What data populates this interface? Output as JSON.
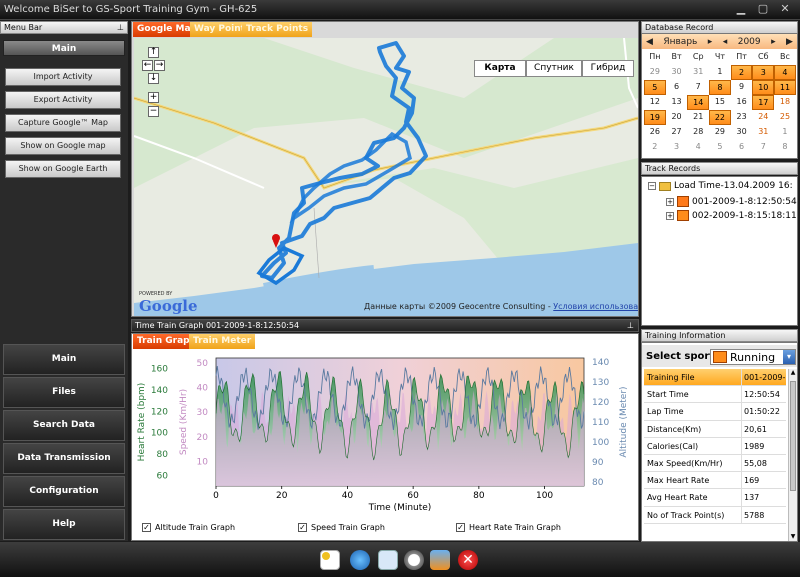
{
  "window": {
    "title": "Welcome BiSer to GS-Sport Training Gym - GH-625"
  },
  "menubar": {
    "header": "Menu Bar",
    "top_button": "Main",
    "items": [
      "Import Activity",
      "Export Activity",
      "Capture Google™ Map",
      "Show on Google map",
      "Show on Google Earth"
    ],
    "nav": [
      "Main",
      "Files",
      "Search Data",
      "Data Transmission",
      "Configuration",
      "Help"
    ]
  },
  "map": {
    "tabs": [
      "Google Map",
      "Way Points",
      "Track Points"
    ],
    "types": [
      "Карта",
      "Спутник",
      "Гибрид"
    ],
    "powered": "POWERED BY",
    "logo": "Google",
    "credit": "Данные карты ©2009 Geocentre Consulting - ",
    "credit_link": "Условия использования"
  },
  "graph": {
    "header": "Time Train Graph 001-2009-1-8:12:50:54",
    "tabs": [
      "Train Graph",
      "Train Meter"
    ],
    "checkboxes": [
      "Altitude Train Graph",
      "Speed Train Graph",
      "Heart Rate Train Graph"
    ]
  },
  "chart_data": {
    "type": "line",
    "xlabel": "Time (Minute)",
    "xlim": [
      0,
      112
    ],
    "x_ticks": [
      "0",
      "20",
      "40",
      "60",
      "80",
      "100"
    ],
    "axes": [
      {
        "label": "Heart Rate (bpm)",
        "ticks": [
          "60",
          "80",
          "100",
          "120",
          "140",
          "160"
        ],
        "ylim": [
          50,
          170
        ],
        "color": "#2a7a3a"
      },
      {
        "label": "Speed (Km/Hr)",
        "ticks": [
          "10",
          "20",
          "30",
          "40",
          "50"
        ],
        "ylim": [
          0,
          52
        ],
        "color": "#c28ac2"
      },
      {
        "label": "Altitude (Meter)",
        "ticks": [
          "80",
          "90",
          "100",
          "110",
          "120",
          "130",
          "140"
        ],
        "ylim": [
          78,
          142
        ],
        "color": "#6a8ab0"
      }
    ]
  },
  "calendar": {
    "header": "Database Record",
    "month": "Январь",
    "year": "2009",
    "weekdays": [
      "Пн",
      "Вт",
      "Ср",
      "Чт",
      "Пт",
      "Сб",
      "Вс"
    ],
    "weeks": [
      [
        "29",
        "30",
        "31",
        "1",
        "2",
        "3",
        "4"
      ],
      [
        "5",
        "6",
        "7",
        "8",
        "9",
        "10",
        "11"
      ],
      [
        "12",
        "13",
        "14",
        "15",
        "16",
        "17",
        "18"
      ],
      [
        "19",
        "20",
        "21",
        "22",
        "23",
        "24",
        "25"
      ],
      [
        "26",
        "27",
        "28",
        "29",
        "30",
        "31",
        "1"
      ],
      [
        "2",
        "3",
        "4",
        "5",
        "6",
        "7",
        "8"
      ]
    ],
    "highlighted": [
      "2",
      "3",
      "4",
      "5",
      "8",
      "10",
      "11",
      "14",
      "17",
      "19",
      "22"
    ]
  },
  "tracks": {
    "header": "Track Records",
    "root": "Load Time-13.04.2009 16:",
    "children": [
      "001-2009-1-8:12:50:54",
      "002-2009-1-8:15:18:11"
    ]
  },
  "info": {
    "header": "Training Information",
    "sport_label": "Select sport",
    "sport_value": "Running",
    "rows": [
      {
        "k": "Training File",
        "v": "001-2009-"
      },
      {
        "k": "Start Time",
        "v": "12:50:54"
      },
      {
        "k": "Lap Time",
        "v": "01:50:22"
      },
      {
        "k": "Distance(Km)",
        "v": "20,61"
      },
      {
        "k": "Calories(Cal)",
        "v": "1989"
      },
      {
        "k": "Max Speed(Km/Hr)",
        "v": "55,08"
      },
      {
        "k": "Max Heart Rate",
        "v": "169"
      },
      {
        "k": "Avg Heart Rate",
        "v": "137"
      },
      {
        "k": "No of Track Point(s)",
        "v": "5788"
      }
    ]
  },
  "colors": {
    "accent_orange": "#ff8c1a",
    "route_blue": "#1a7ad8"
  }
}
